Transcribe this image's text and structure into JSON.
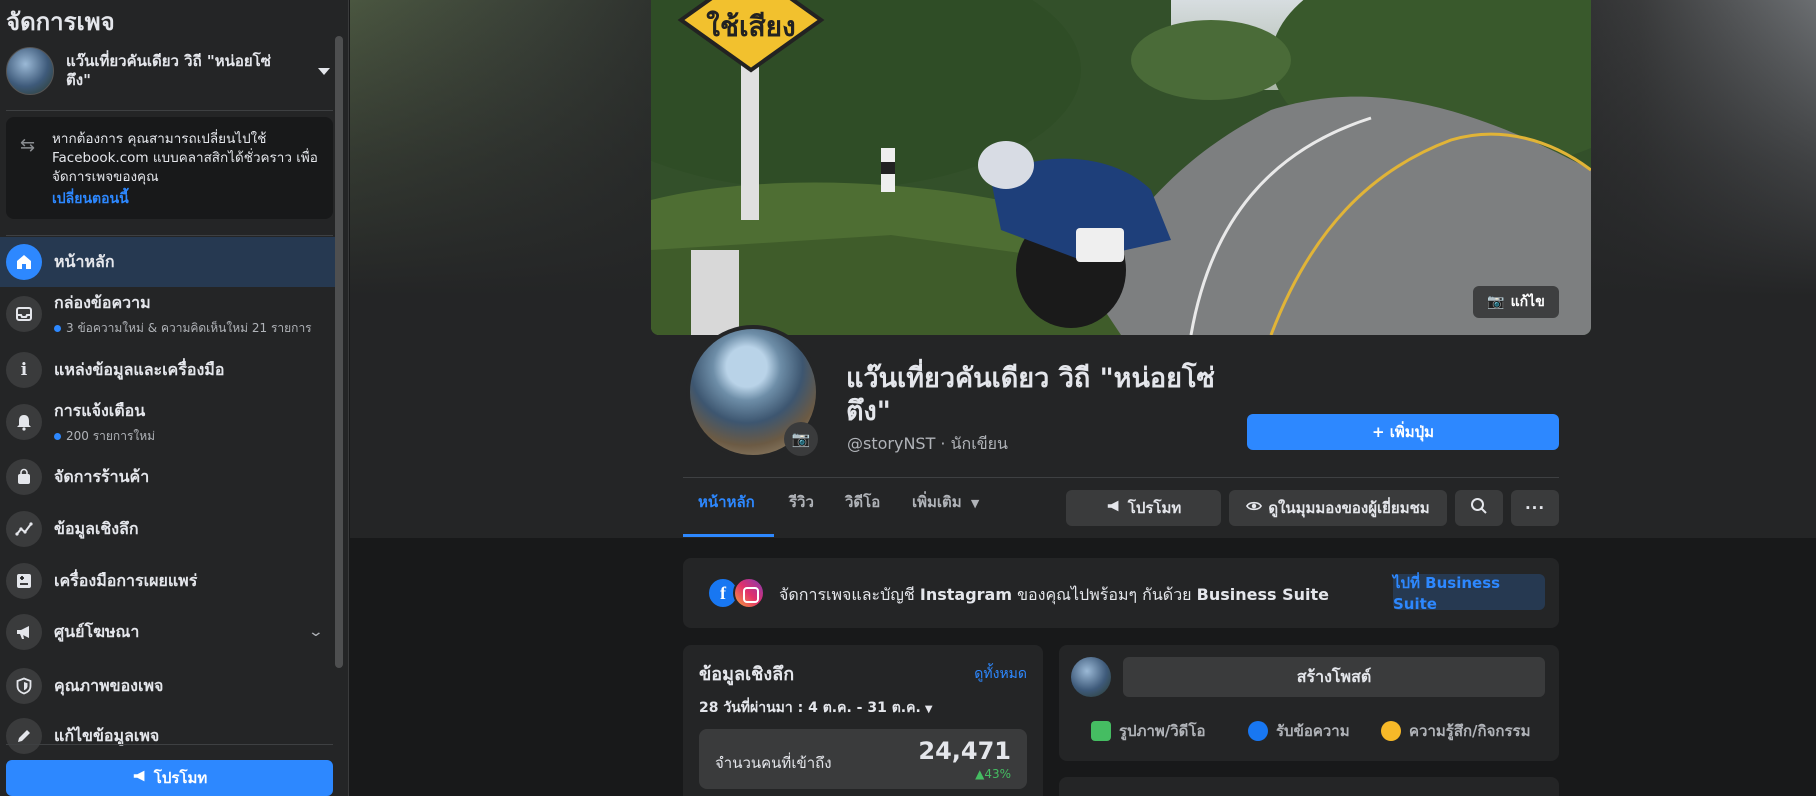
{
  "sidebar": {
    "title": "จัดการเพจ",
    "page_name": "แว๊นเที่ยวคันเดียว วิถี \"หน่อยโซ่ ตึง\"",
    "notice": {
      "text": "หากต้องการ คุณสามารถเปลี่ยนไปใช้ Facebook.com แบบคลาสสิกได้ชั่วคราว เพื่อจัดการเพจของคุณ",
      "link": "เปลี่ยนตอนนี้"
    },
    "items": [
      {
        "label": "หน้าหลัก",
        "icon": "home-icon"
      },
      {
        "label": "กล่องข้อความ",
        "sub": "3 ข้อความใหม่ & ความคิดเห็นใหม่ 21 รายการ",
        "icon": "inbox-icon"
      },
      {
        "label": "แหล่งข้อมูลและเครื่องมือ",
        "icon": "info-icon"
      },
      {
        "label": "การแจ้งเตือน",
        "sub": "200 รายการใหม่",
        "icon": "bell-icon"
      },
      {
        "label": "จัดการร้านค้า",
        "icon": "shopping-bag-icon"
      },
      {
        "label": "ข้อมูลเชิงลึก",
        "icon": "insights-icon"
      },
      {
        "label": "เครื่องมือการเผยแพร่",
        "icon": "publishing-tools-icon"
      },
      {
        "label": "ศูนย์โฆษณา",
        "icon": "megaphone-icon"
      },
      {
        "label": "คุณภาพของเพจ",
        "icon": "shield-icon"
      },
      {
        "label": "แก้ไขข้อมูลเพจ",
        "icon": "pencil-icon"
      }
    ],
    "promote_label": "โปรโมท"
  },
  "header": {
    "edit_cover_label": "แก้ไข",
    "page_name": "แว๊นเที่ยวคันเดียว วิถี \"หน่อยโซ่ ตึง\"",
    "handle": "@storyNST · นักเขียน",
    "add_button_label": "+ เพิ่มปุ่ม",
    "cover_sign_text": "ใช้เสียง"
  },
  "tabs": [
    {
      "label": "หน้าหลัก",
      "active": true
    },
    {
      "label": "รีวิว"
    },
    {
      "label": "วิดีโอ"
    },
    {
      "label": "เพิ่มเติม"
    }
  ],
  "actions": {
    "promote": "โปรโมท",
    "view_as_visitor": "ดูในมุมมองของผู้เยี่ยมชม"
  },
  "business_suite": {
    "text_prefix": "จัดการเพจและบัญชี ",
    "text_bold1": "Instagram",
    "text_mid": " ของคุณไปพร้อมๆ กันด้วย ",
    "text_bold2": "Business Suite",
    "button": "ไปที่ Business Suite"
  },
  "insights": {
    "title": "ข้อมูลเชิงลึก",
    "see_all": "ดูทั้งหมด",
    "range": "28 วันที่ผ่านมา : 4 ต.ค. - 31 ต.ค.",
    "reach_label": "จำนวนคนที่เข้าถึง",
    "reach_value": "24,471",
    "reach_change": "43%"
  },
  "composer": {
    "create_post": "สร้างโพสต์",
    "photo_video": "รูปภาพ/วิดีโอ",
    "get_messages": "รับข้อความ",
    "feeling": "ความรู้สึก/กิจกรรม"
  },
  "colors": {
    "accent": "#2d88ff",
    "surface": "#242526",
    "background": "#18191a",
    "positive": "#45bd62"
  }
}
